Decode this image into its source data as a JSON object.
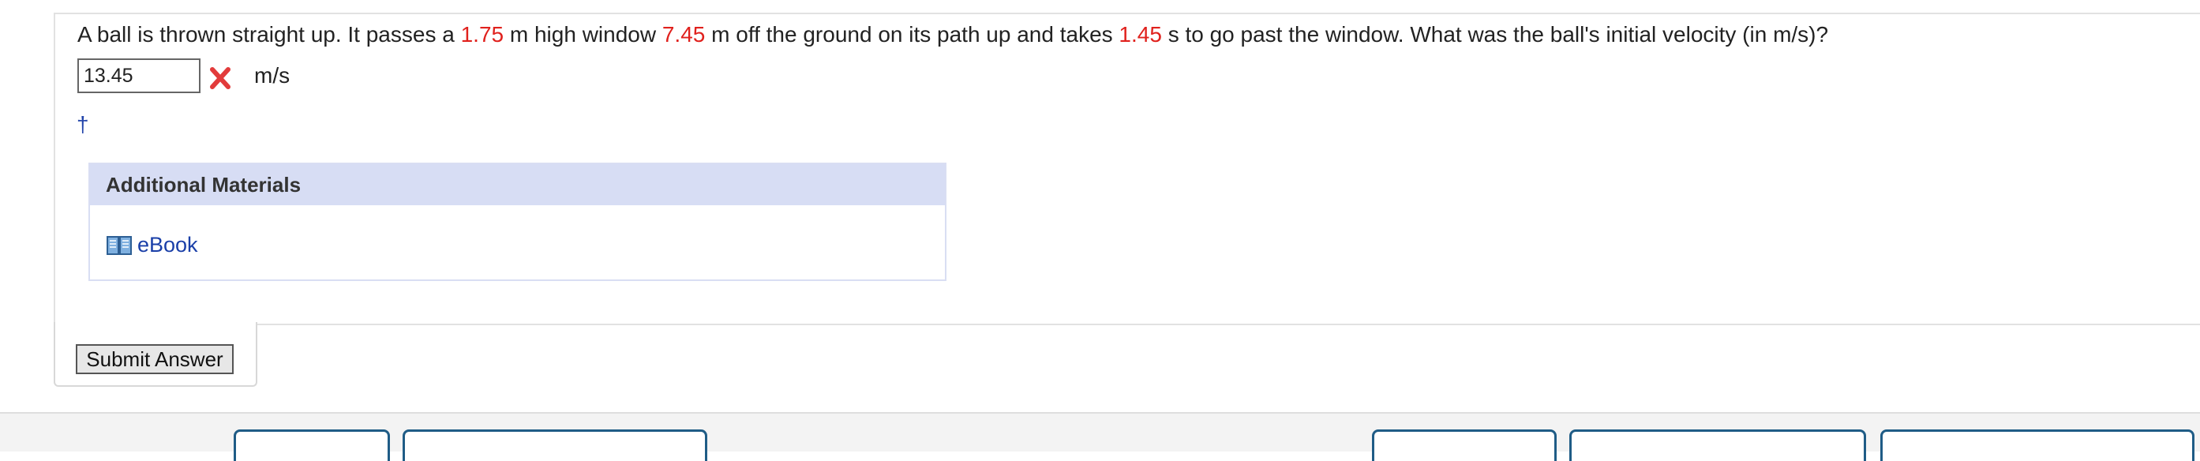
{
  "question": {
    "parts": [
      "A ball is thrown straight up. It passes a ",
      "1.75",
      " m high window ",
      "7.45",
      " m off the ground on its path up and takes ",
      "1.45",
      " s to go past the window. What was the ball's initial velocity (in m/s)?"
    ]
  },
  "answer": {
    "value": "13.45",
    "status_icon": "incorrect-x-icon",
    "unit": "m/s"
  },
  "dagger": "†",
  "materials": {
    "header": "Additional Materials",
    "ebook_label": "eBook",
    "ebook_icon": "book-icon"
  },
  "submit": {
    "label": "Submit Answer"
  },
  "colors": {
    "highlight": "#e0211d",
    "link": "#1a3fa8",
    "materials_header_bg": "#d7ddf4",
    "tab_border": "#1f5c86"
  }
}
